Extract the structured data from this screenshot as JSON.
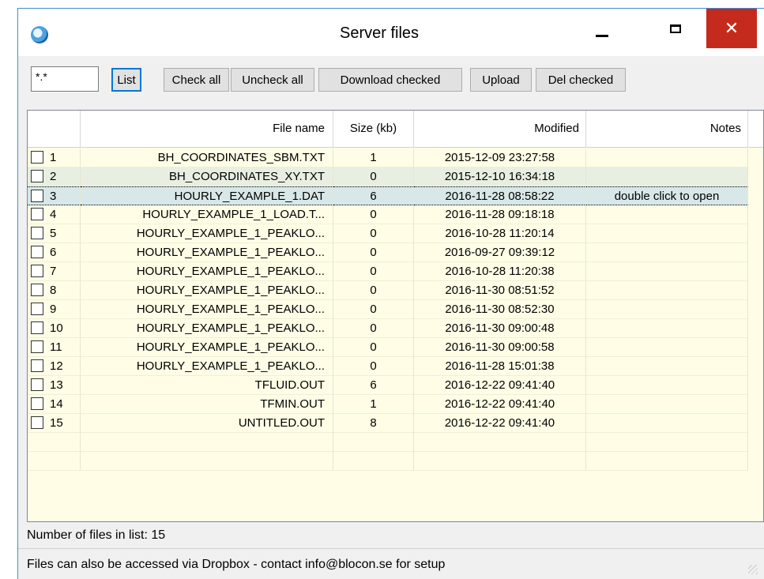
{
  "window": {
    "title": "Server files"
  },
  "toolbar": {
    "filter_value": "*.*",
    "list_label": "List",
    "check_all_label": "Check all",
    "uncheck_all_label": "Uncheck all",
    "download_label": "Download checked",
    "upload_label": "Upload",
    "del_label": "Del checked"
  },
  "columns": [
    "",
    "File name",
    "Size (kb)",
    "Modified",
    "Notes"
  ],
  "rows": [
    {
      "num": "1",
      "name": "BH_COORDINATES_SBM.TXT",
      "size": "1",
      "modified": "2015-12-09 23:27:58",
      "notes": ""
    },
    {
      "num": "2",
      "name": "BH_COORDINATES_XY.TXT",
      "size": "0",
      "modified": "2015-12-10 16:34:18",
      "notes": ""
    },
    {
      "num": "3",
      "name": "HOURLY_EXAMPLE_1.DAT",
      "size": "6",
      "modified": "2016-11-28 08:58:22",
      "notes": "double click to open"
    },
    {
      "num": "4",
      "name": "HOURLY_EXAMPLE_1_LOAD.T...",
      "size": "0",
      "modified": "2016-11-28 09:18:18",
      "notes": ""
    },
    {
      "num": "5",
      "name": "HOURLY_EXAMPLE_1_PEAKLO...",
      "size": "0",
      "modified": "2016-10-28 11:20:14",
      "notes": ""
    },
    {
      "num": "6",
      "name": "HOURLY_EXAMPLE_1_PEAKLO...",
      "size": "0",
      "modified": "2016-09-27 09:39:12",
      "notes": ""
    },
    {
      "num": "7",
      "name": "HOURLY_EXAMPLE_1_PEAKLO...",
      "size": "0",
      "modified": "2016-10-28 11:20:38",
      "notes": ""
    },
    {
      "num": "8",
      "name": "HOURLY_EXAMPLE_1_PEAKLO...",
      "size": "0",
      "modified": "2016-11-30 08:51:52",
      "notes": ""
    },
    {
      "num": "9",
      "name": "HOURLY_EXAMPLE_1_PEAKLO...",
      "size": "0",
      "modified": "2016-11-30 08:52:30",
      "notes": ""
    },
    {
      "num": "10",
      "name": "HOURLY_EXAMPLE_1_PEAKLO...",
      "size": "0",
      "modified": "2016-11-30 09:00:48",
      "notes": ""
    },
    {
      "num": "11",
      "name": "HOURLY_EXAMPLE_1_PEAKLO...",
      "size": "0",
      "modified": "2016-11-30 09:00:58",
      "notes": ""
    },
    {
      "num": "12",
      "name": "HOURLY_EXAMPLE_1_PEAKLO...",
      "size": "0",
      "modified": "2016-11-28 15:01:38",
      "notes": ""
    },
    {
      "num": "13",
      "name": "TFLUID.OUT",
      "size": "6",
      "modified": "2016-12-22 09:41:40",
      "notes": ""
    },
    {
      "num": "14",
      "name": "TFMIN.OUT",
      "size": "1",
      "modified": "2016-12-22 09:41:40",
      "notes": ""
    },
    {
      "num": "15",
      "name": "UNTITLED.OUT",
      "size": "8",
      "modified": "2016-12-22 09:41:40",
      "notes": ""
    }
  ],
  "status": {
    "count_text": "Number of files in list: 15",
    "info_text": "Files can also be accessed via Dropbox - contact info@blocon.se for setup"
  }
}
